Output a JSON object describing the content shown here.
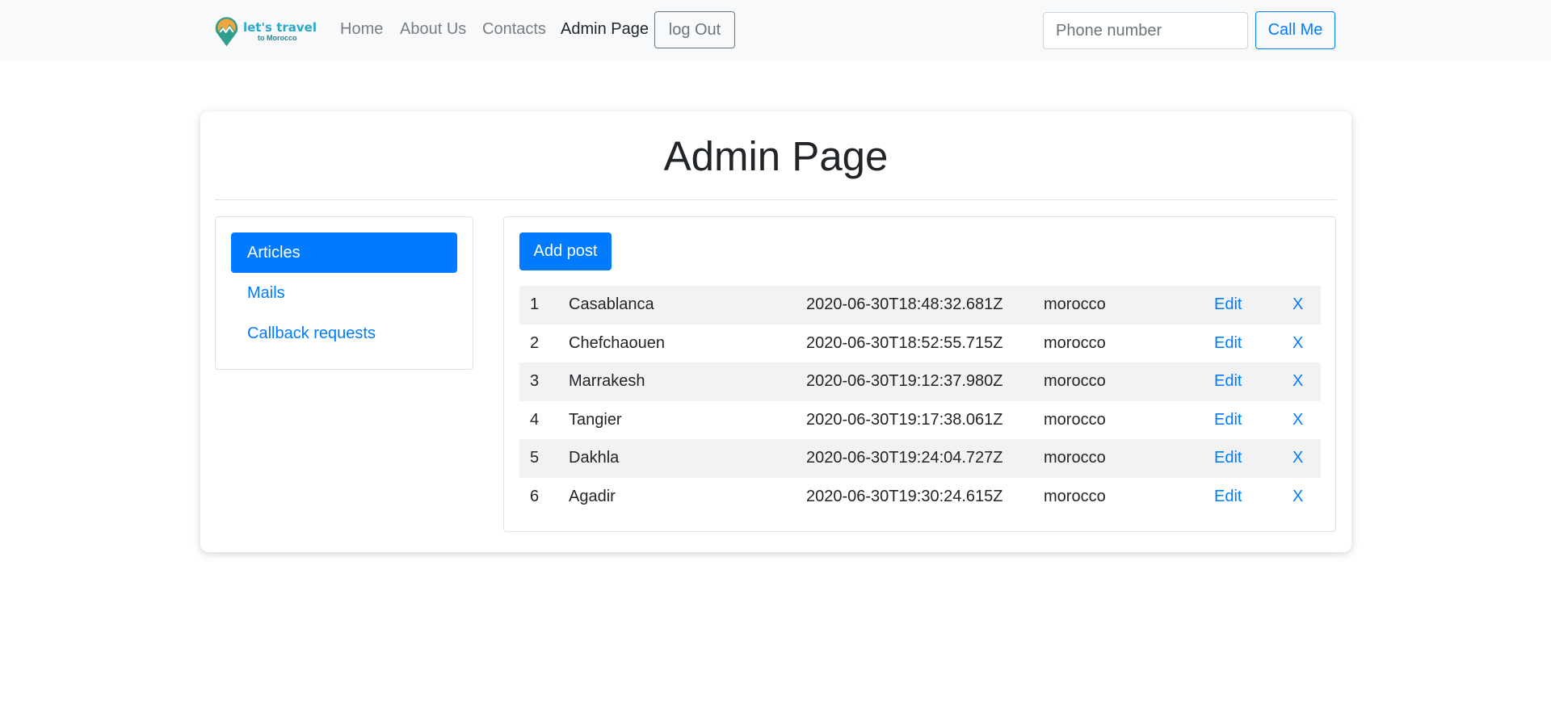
{
  "brand": {
    "line1": "let's travel",
    "line2": "to Morocco"
  },
  "nav": {
    "items": [
      {
        "label": "Home"
      },
      {
        "label": "About Us"
      },
      {
        "label": "Contacts"
      },
      {
        "label": "Admin Page"
      }
    ],
    "logout_label": "log Out"
  },
  "callback": {
    "placeholder": "Phone number",
    "button_label": "Call Me"
  },
  "page": {
    "title": "Admin Page"
  },
  "sidebar": {
    "items": [
      {
        "label": "Articles",
        "active": true
      },
      {
        "label": "Mails"
      },
      {
        "label": "Callback requests"
      }
    ]
  },
  "articles": {
    "add_label": "Add post",
    "rows": [
      {
        "id": "1",
        "title": "Casablanca",
        "date": "2020-06-30T18:48:32.681Z",
        "country": "morocco",
        "edit": "Edit",
        "delete": "X"
      },
      {
        "id": "2",
        "title": "Chefchaouen",
        "date": "2020-06-30T18:52:55.715Z",
        "country": "morocco",
        "edit": "Edit",
        "delete": "X"
      },
      {
        "id": "3",
        "title": "Marrakesh",
        "date": "2020-06-30T19:12:37.980Z",
        "country": "morocco",
        "edit": "Edit",
        "delete": "X"
      },
      {
        "id": "4",
        "title": "Tangier",
        "date": "2020-06-30T19:17:38.061Z",
        "country": "morocco",
        "edit": "Edit",
        "delete": "X"
      },
      {
        "id": "5",
        "title": "Dakhla",
        "date": "2020-06-30T19:24:04.727Z",
        "country": "morocco",
        "edit": "Edit",
        "delete": "X"
      },
      {
        "id": "6",
        "title": "Agadir",
        "date": "2020-06-30T19:30:24.615Z",
        "country": "morocco",
        "edit": "Edit",
        "delete": "X"
      }
    ]
  },
  "colors": {
    "primary": "#007bff",
    "navbar_bg": "#f8f9fa",
    "stripe": "#f2f2f2",
    "secondary": "#6c757d"
  },
  "icons": {
    "logo": "map-pin-mountain-icon"
  }
}
